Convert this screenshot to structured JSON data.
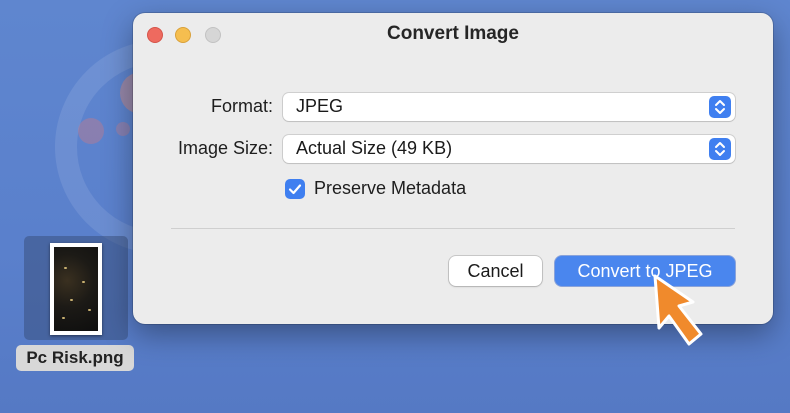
{
  "dialog": {
    "title": "Convert Image",
    "format_label": "Format:",
    "format_value": "JPEG",
    "size_label": "Image Size:",
    "size_value": "Actual Size (49 KB)",
    "preserve_label": "Preserve Metadata",
    "preserve_checked": true,
    "cancel_label": "Cancel",
    "convert_label": "Convert to JPEG"
  },
  "desktop": {
    "file_name": "Pc Risk.png"
  },
  "colors": {
    "accent": "#4a86ee",
    "close": "#ee6a5f",
    "minimize": "#f5be4f",
    "maximize": "#d6d6d6",
    "pointer": "#f08a2c"
  }
}
